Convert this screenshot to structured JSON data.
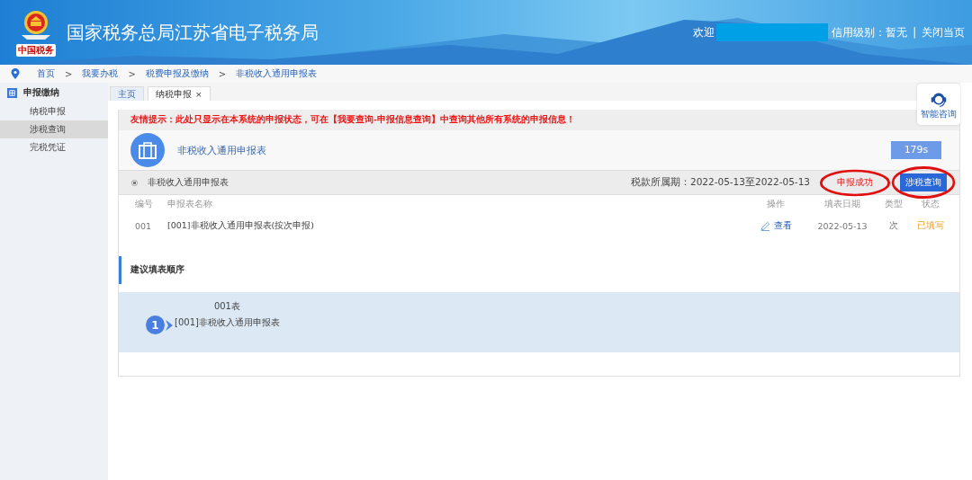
{
  "header": {
    "logo_text": "中国税务",
    "title": "国家税务总局江苏省电子税务局",
    "welcome": "欢迎",
    "credit_level": "信用级别：暂无",
    "divider": "|",
    "close_link": "关闭当页"
  },
  "breadcrumb": {
    "separator": ">",
    "items": [
      "首页",
      "我要办税",
      "税费申报及缴纳",
      "非税收入通用申报表"
    ]
  },
  "sidebar": {
    "section": "申报缴纳",
    "items": [
      {
        "label": "纳税申报",
        "selected": false
      },
      {
        "label": "涉税查询",
        "selected": true
      },
      {
        "label": "完税凭证",
        "selected": false
      }
    ]
  },
  "tabs": [
    {
      "label": "主页",
      "selected": false
    },
    {
      "label": "纳税申报",
      "selected": true,
      "close": "×"
    }
  ],
  "notice": "友情提示：此处只显示在本系统的申报状态，可在【我要查询-申报信息查询】中查询其他所有系统的申报信息！",
  "form": {
    "title": "非税收入通用申报表",
    "timer": "179s"
  },
  "declaration": {
    "name": "非税收入通用申报表",
    "selected": true,
    "period": "税款所属期：2022-05-13至2022-05-13",
    "status": "申报成功",
    "query_button": "涉税查询"
  },
  "table": {
    "columns": [
      "编号",
      "申报表名称",
      "操作",
      "填表日期",
      "类型",
      "状态"
    ],
    "rows": [
      {
        "number": "001",
        "name": "[001]非税收入通用申报表(按次申报)",
        "action": "查看",
        "date": "2022-05-13",
        "type": "次",
        "status": "已填写"
      }
    ]
  },
  "order": {
    "heading": "建议填表顺序",
    "steps": [
      {
        "index": "1",
        "code": "001表",
        "name": "[001]非税收入通用申报表"
      }
    ]
  },
  "consult": {
    "label": "智能咨询"
  }
}
